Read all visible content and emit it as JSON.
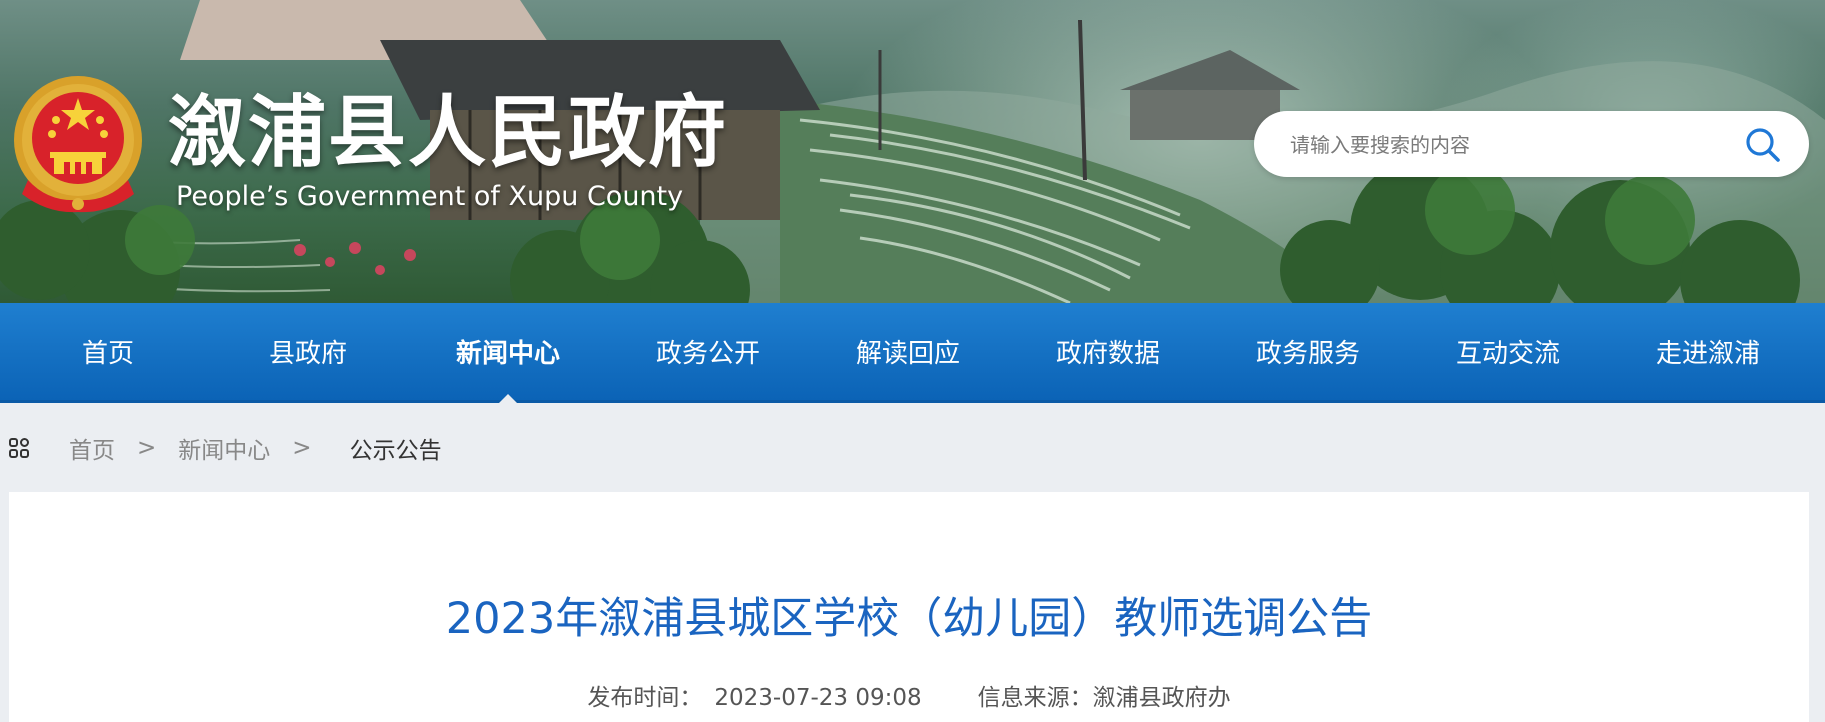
{
  "header": {
    "title": "溆浦县人民政府",
    "subtitle": "People’s Government of Xupu County",
    "emblem": "national-emblem-icon"
  },
  "search": {
    "placeholder": "请输入要搜索的内容",
    "icon": "search-icon"
  },
  "nav": {
    "items": [
      {
        "label": "首页"
      },
      {
        "label": "县政府"
      },
      {
        "label": "新闻中心",
        "active": true
      },
      {
        "label": "政务公开"
      },
      {
        "label": "解读回应"
      },
      {
        "label": "政府数据"
      },
      {
        "label": "政务服务"
      },
      {
        "label": "互动交流"
      },
      {
        "label": "走进溆浦"
      }
    ]
  },
  "breadcrumb": {
    "icon": "grid-apps-icon",
    "items": [
      "首页",
      "新闻中心",
      "公示公告"
    ],
    "separator": ">"
  },
  "article": {
    "title": "2023年溆浦县城区学校（幼儿园）教师选调公告",
    "publish_label": "发布时间：",
    "publish_time": "2023-07-23 09:08",
    "source_label": "信息来源：",
    "source": "溆浦县政府办"
  },
  "colors": {
    "nav_blue": "#0b63b6",
    "title_blue": "#1a64c0",
    "page_bg": "#ebeef2"
  }
}
